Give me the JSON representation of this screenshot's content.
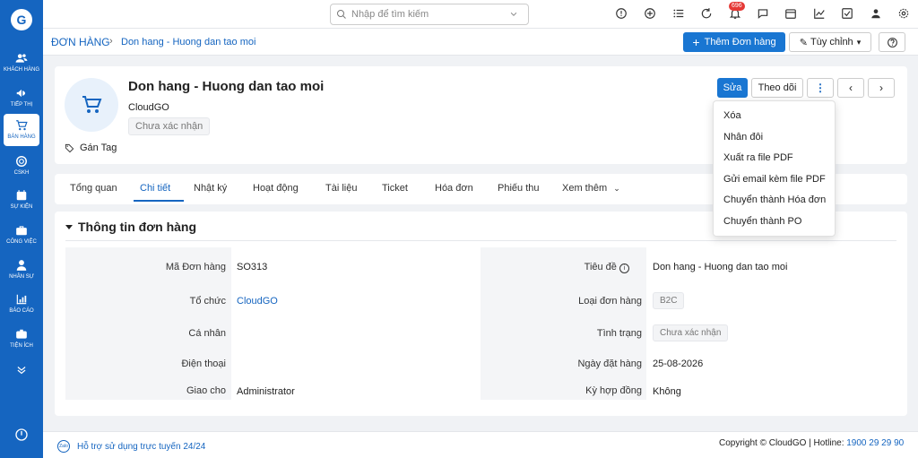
{
  "sidebar": {
    "logo": "G",
    "items": [
      {
        "label": "KHÁCH HÀNG",
        "icon": "users-icon"
      },
      {
        "label": "TIẾP THỊ",
        "icon": "megaphone-icon"
      },
      {
        "label": "BÁN HÀNG",
        "icon": "cart-icon"
      },
      {
        "label": "CSKH",
        "icon": "support-icon"
      },
      {
        "label": "SỰ KIỆN",
        "icon": "calendar-icon"
      },
      {
        "label": "CÔNG VIỆC",
        "icon": "briefcase-icon"
      },
      {
        "label": "NHÂN SỰ",
        "icon": "person-icon"
      },
      {
        "label": "BÁO CÁO",
        "icon": "report-icon"
      },
      {
        "label": "TIỆN ÍCH",
        "icon": "utilities-icon"
      }
    ]
  },
  "topbar": {
    "search_placeholder": "Nhập để tìm kiếm",
    "notification_count": "696"
  },
  "breadcrumb": {
    "root": "ĐƠN HÀNG",
    "current": "Don hang - Huong dan tao moi"
  },
  "toolbar": {
    "add_label": "Thêm Đơn hàng",
    "customize_label": "Tùy chỉnh"
  },
  "record": {
    "title": "Don hang - Huong dan tao moi",
    "organization": "CloudGO",
    "status": "Chưa xác nhận",
    "tag_label": "Gán Tag",
    "edit_label": "Sửa",
    "follow_label": "Theo dõi"
  },
  "tabs": [
    {
      "label": "Tổng quan"
    },
    {
      "label": "Chi tiết"
    },
    {
      "label": "Nhật ký"
    },
    {
      "label": "Hoạt động"
    },
    {
      "label": "Tài liệu"
    },
    {
      "label": "Ticket"
    },
    {
      "label": "Hóa đơn"
    },
    {
      "label": "Phiếu thu"
    },
    {
      "label": "Xem thêm"
    }
  ],
  "active_tab": "Chi tiết",
  "section": {
    "title": "Thông tin đơn hàng",
    "left_fields": [
      {
        "label": "Mã Đơn hàng",
        "value": "SO313"
      },
      {
        "label": "Tổ chức",
        "value": "CloudGO"
      },
      {
        "label": "Cá nhân",
        "value": ""
      },
      {
        "label": "Điện thoại",
        "value": ""
      },
      {
        "label": "Giao cho",
        "value": "Administrator"
      }
    ],
    "right_fields": [
      {
        "label": "Tiêu đề",
        "value": "Don hang - Huong dan tao moi"
      },
      {
        "label": "Loại đơn hàng",
        "value": "B2C"
      },
      {
        "label": "Tình trạng",
        "value": "Chưa xác nhận"
      },
      {
        "label": "Ngày đặt hàng",
        "value": "25-08-2026"
      },
      {
        "label": "Kỳ hợp đồng",
        "value": "Không"
      }
    ]
  },
  "menu": {
    "items": [
      {
        "label": "Xóa"
      },
      {
        "label": "Nhân đôi"
      },
      {
        "label": "Xuất ra file PDF"
      },
      {
        "label": "Gửi email kèm file PDF"
      },
      {
        "label": "Chuyển thành Hóa đơn"
      },
      {
        "label": "Chuyển thành PO"
      }
    ]
  },
  "footer": {
    "zalo": "Zalo",
    "support": "Hỗ trợ sử dụng trực tuyến 24/24",
    "copyright": "Copyright © CloudGO | Hotline:",
    "hotline": "1900 29 29 90"
  },
  "colors": {
    "primary": "#1565c0",
    "button": "#1976d2",
    "badge": "#e53935"
  }
}
